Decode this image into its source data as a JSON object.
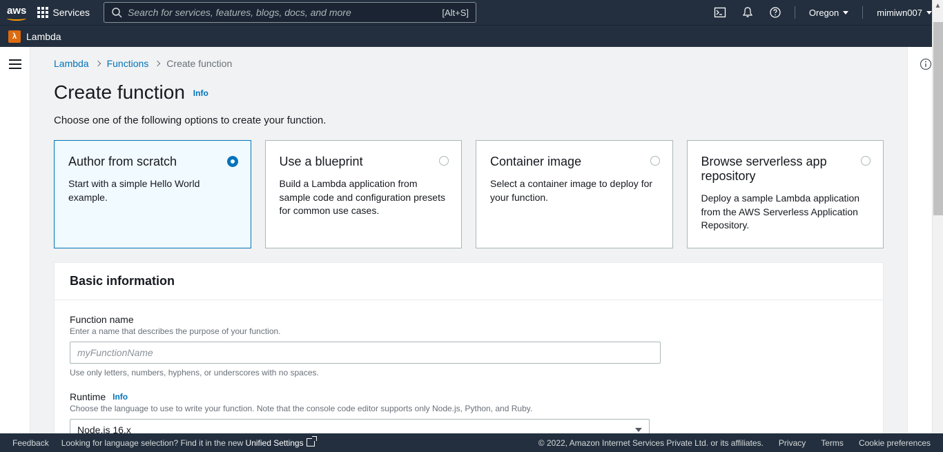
{
  "topbar": {
    "logo": "aws",
    "services_label": "Services",
    "search_placeholder": "Search for services, features, blogs, docs, and more",
    "search_shortcut": "[Alt+S]",
    "region": "Oregon",
    "username": "mimiwn007"
  },
  "subbar": {
    "service_icon": "λ",
    "service_name": "Lambda"
  },
  "breadcrumb": {
    "root": "Lambda",
    "mid": "Functions",
    "current": "Create function"
  },
  "page": {
    "title": "Create function",
    "info": "Info",
    "subtitle": "Choose one of the following options to create your function."
  },
  "options": [
    {
      "title": "Author from scratch",
      "desc": "Start with a simple Hello World example.",
      "selected": true
    },
    {
      "title": "Use a blueprint",
      "desc": "Build a Lambda application from sample code and configuration presets for common use cases.",
      "selected": false
    },
    {
      "title": "Container image",
      "desc": "Select a container image to deploy for your function.",
      "selected": false
    },
    {
      "title": "Browse serverless app repository",
      "desc": "Deploy a sample Lambda application from the AWS Serverless Application Repository.",
      "selected": false
    }
  ],
  "basic": {
    "heading": "Basic information",
    "fn_label": "Function name",
    "fn_desc": "Enter a name that describes the purpose of your function.",
    "fn_placeholder": "myFunctionName",
    "fn_constraint": "Use only letters, numbers, hyphens, or underscores with no spaces.",
    "rt_label": "Runtime",
    "rt_info": "Info",
    "rt_desc": "Choose the language to use to write your function. Note that the console code editor supports only Node.js, Python, and Ruby.",
    "rt_value": "Node.js 16.x"
  },
  "footer": {
    "feedback": "Feedback",
    "lang_text": "Looking for language selection? Find it in the new ",
    "lang_link": "Unified Settings",
    "copyright": "© 2022, Amazon Internet Services Private Ltd. or its affiliates.",
    "privacy": "Privacy",
    "terms": "Terms",
    "cookies": "Cookie preferences"
  }
}
